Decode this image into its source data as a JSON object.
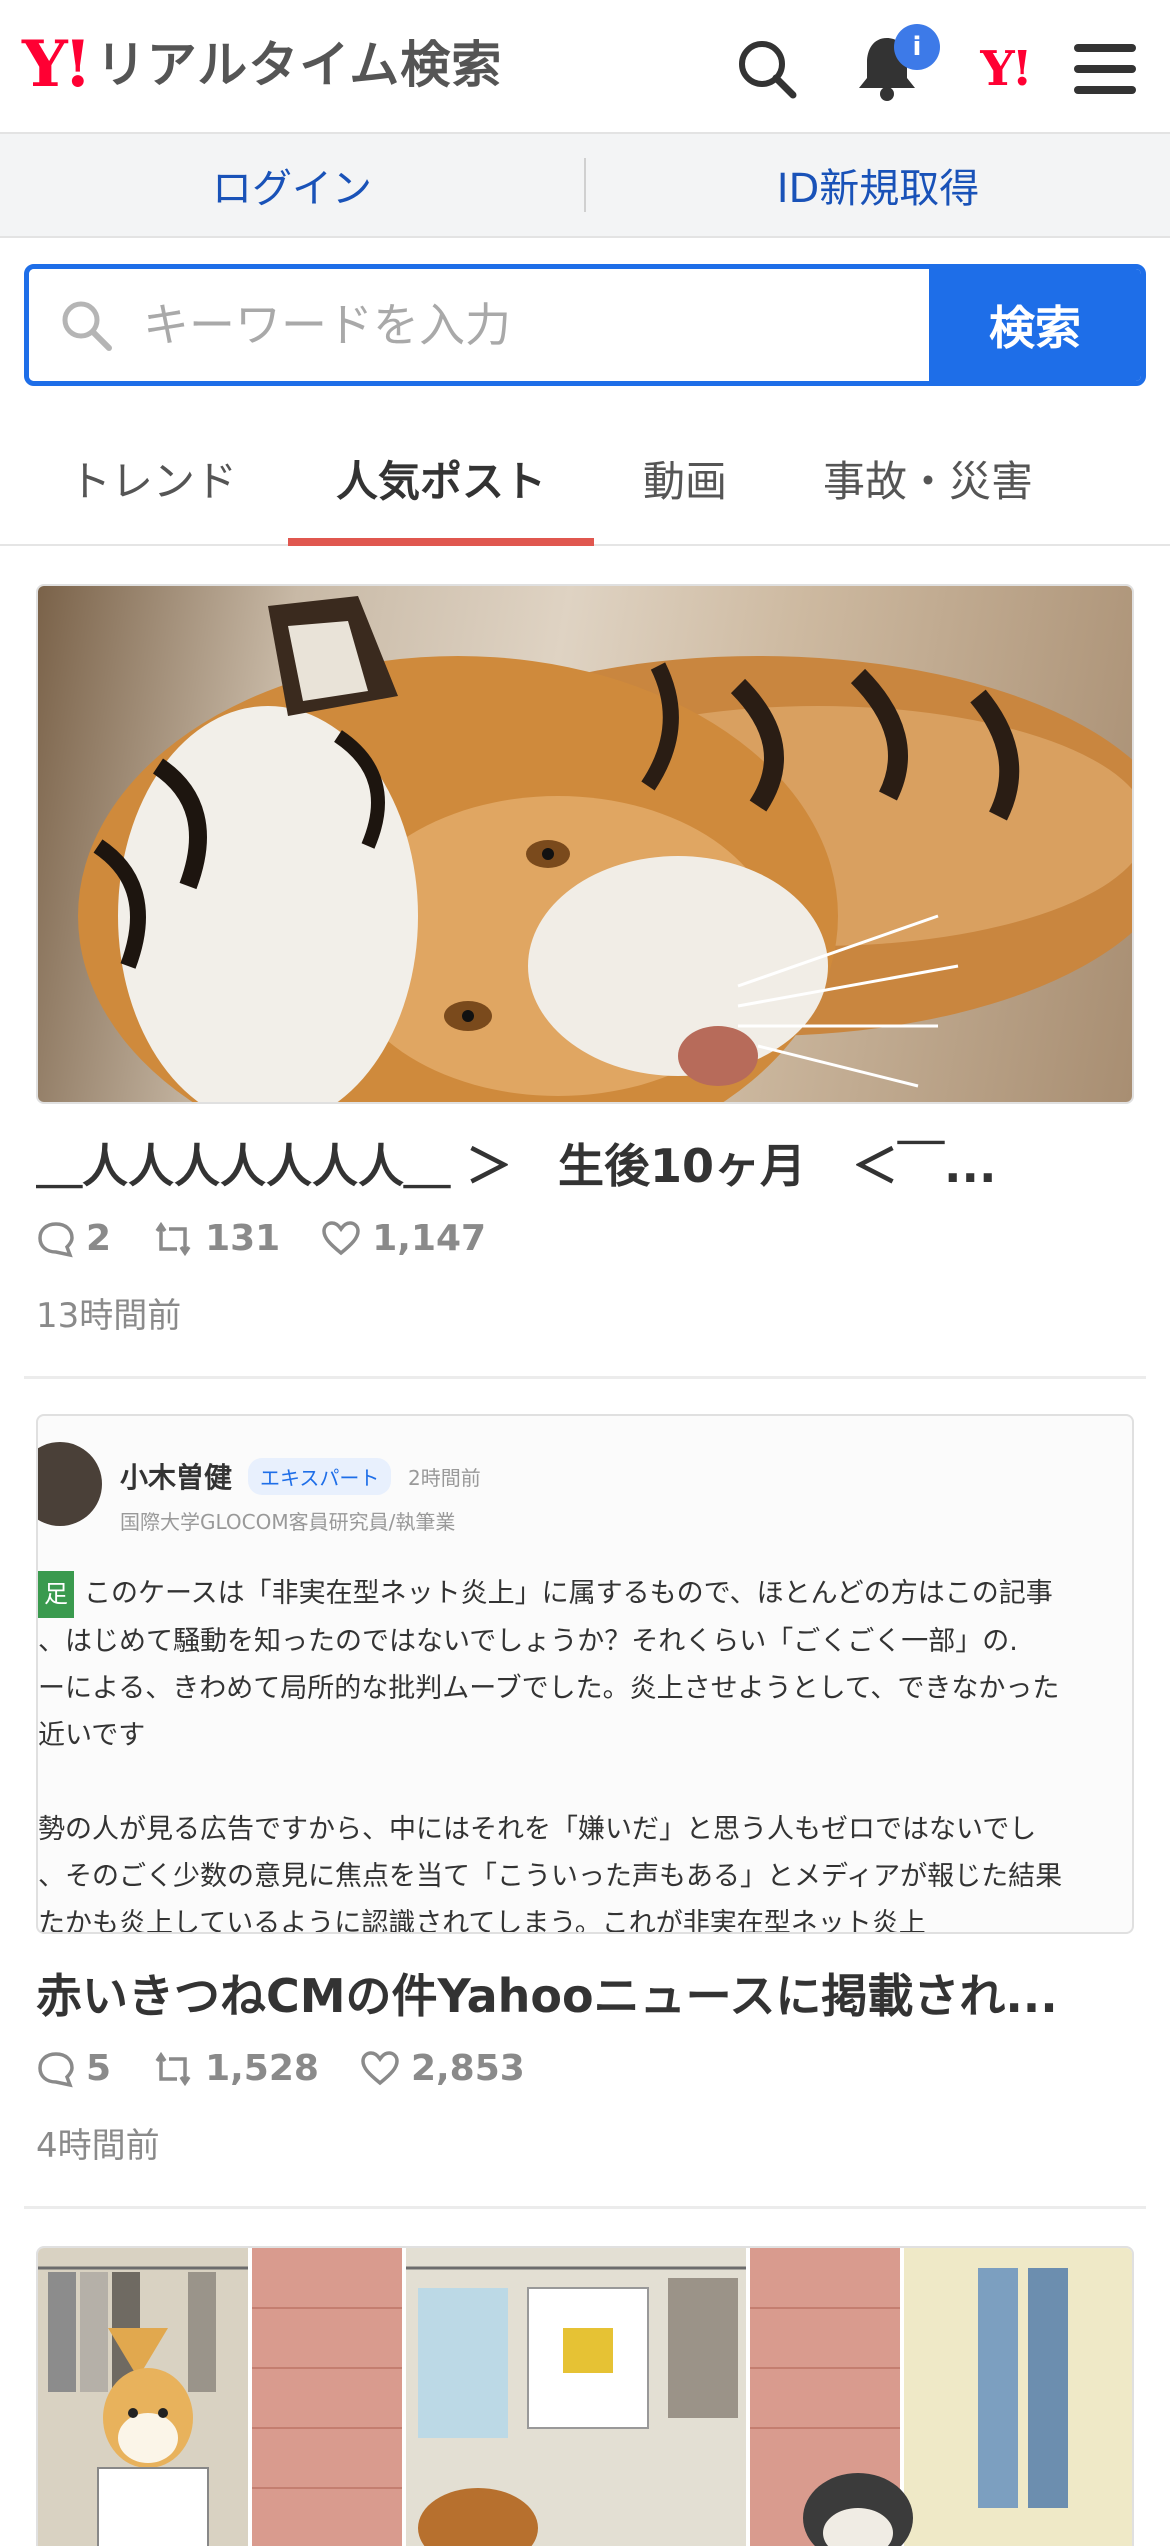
{
  "header": {
    "logo_mark": "Y!",
    "logo_text": "リアルタイム検索",
    "notification_badge": "i",
    "yahoo_mark": "Y!"
  },
  "auth": {
    "login_label": "ログイン",
    "signup_label": "ID新規取得"
  },
  "search": {
    "placeholder": "キーワードを入力",
    "button_label": "検索"
  },
  "tabs": [
    {
      "label": "トレンド",
      "active": false
    },
    {
      "label": "人気ポスト",
      "active": true
    },
    {
      "label": "動画",
      "active": false
    },
    {
      "label": "事故・災害",
      "active": false
    }
  ],
  "posts": [
    {
      "title": "＿人人人人人人人＿ ＞　生後10ヶ月　＜￣...",
      "replies": "2",
      "reposts": "131",
      "likes": "1,147",
      "time": "13時間前",
      "image": "tiger-photo"
    },
    {
      "title": "赤いきつねCMの件Yahooニュースに掲載され...",
      "replies": "5",
      "reposts": "1,528",
      "likes": "2,853",
      "time": "4時間前",
      "image": "article-screenshot",
      "screenshot": {
        "author": "小木曽健",
        "badge": "エキスパート",
        "ago": "2時間前",
        "affiliation": "国際大学GLOCOM客員研究員/執筆業",
        "tag": "足",
        "lines": [
          "このケースは「非実在型ネット炎上」に属するもので、ほとんどの方はこの記事",
          "、はじめて騒動を知ったのではないでしょうか？それくらい「ごくごく一部」の.",
          "ーによる、きわめて局所的な批判ムーブでした。炎上させようとして、できなかった",
          "近いです",
          "",
          "勢の人が見る広告ですから、中にはそれを「嫌いだ」と思う人もゼロではないでし",
          "、そのごく少数の意見に焦点を当て「こういった声もある」とメディアが報じた結果",
          "たかも炎上しているように認識されてしまう。これが非実在型ネット炎上"
        ]
      }
    },
    {
      "image": "cartoon-illustration"
    }
  ],
  "colors": {
    "brand_red": "#ff0033",
    "accent_blue": "#1e6ee8",
    "tab_underline": "#e0574f",
    "link_blue": "#1952b8"
  }
}
